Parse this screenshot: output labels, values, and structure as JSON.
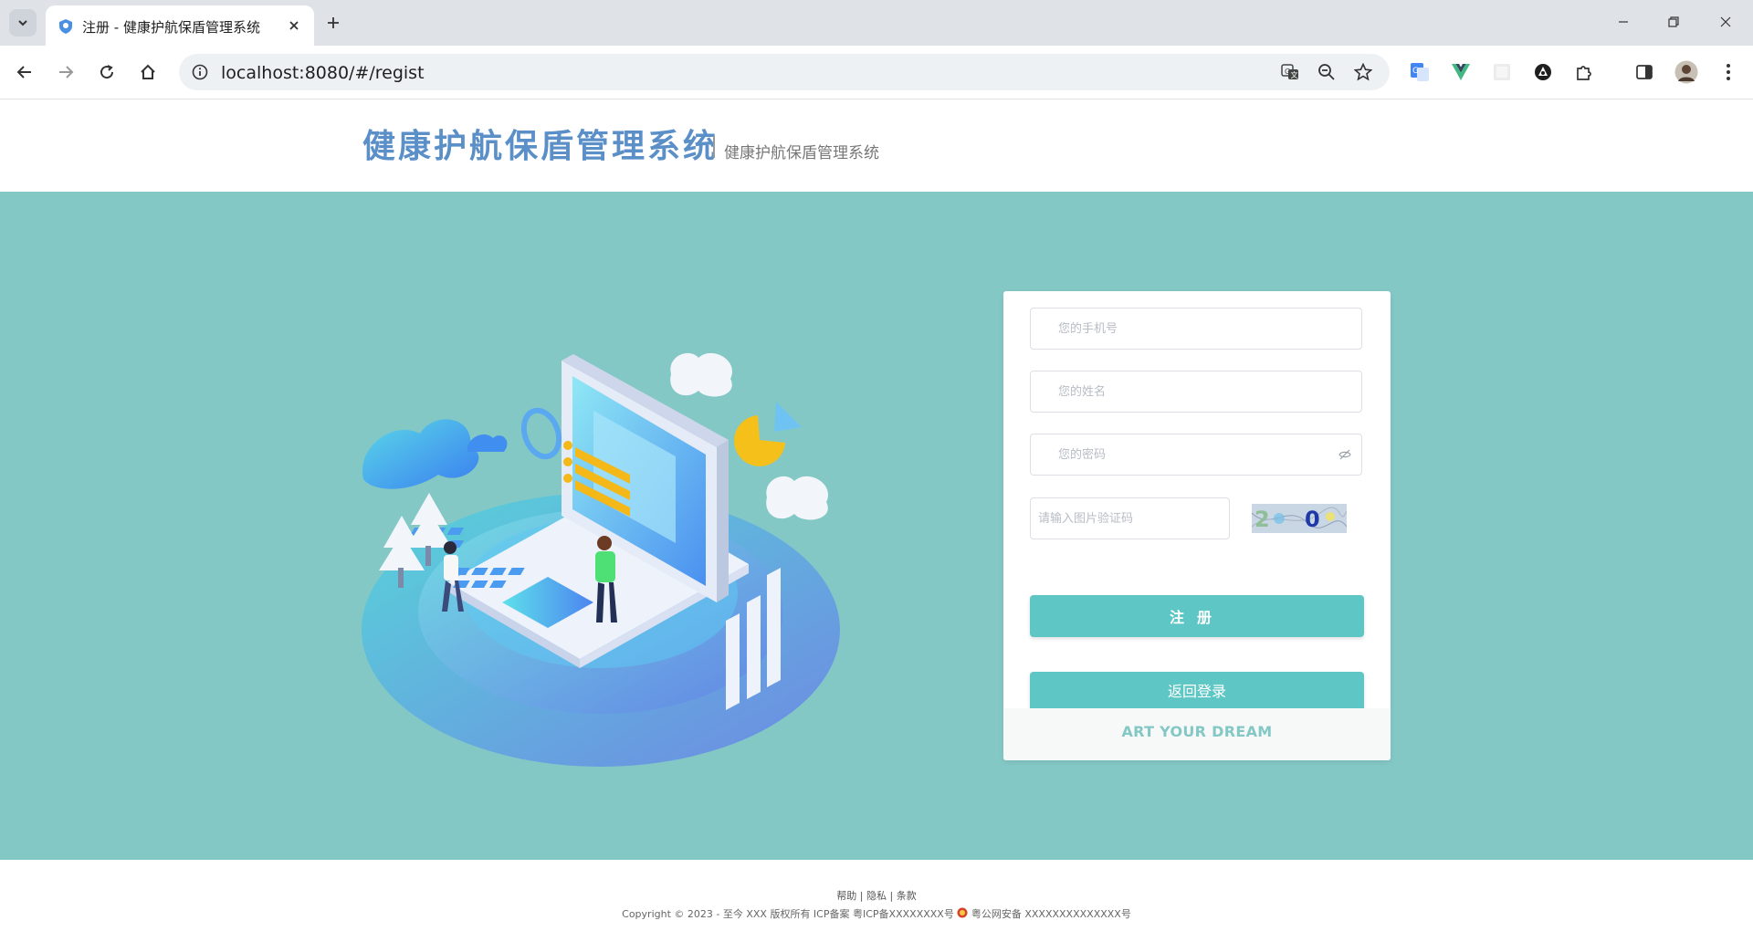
{
  "browser": {
    "tab_title": "注册 - 健康护航保盾管理系统",
    "url": "localhost:8080/#/regist",
    "icons": [
      "tab-search-icon",
      "close-icon",
      "plus-icon",
      "minimize-icon",
      "restore-icon",
      "close-window-icon",
      "back-arrow-icon",
      "forward-arrow-icon",
      "reload-icon",
      "home-icon",
      "site-info-icon",
      "translate-icon",
      "zoom-out-icon",
      "star-icon",
      "google-translate-icon",
      "vue-devtools-icon",
      "blank-extension-icon",
      "extension-icon",
      "puzzle-icon",
      "side-panel-icon",
      "avatar",
      "more-menu-icon"
    ]
  },
  "header": {
    "title": "健康护航保盾管理系统",
    "subtitle": "健康护航保盾管理系统"
  },
  "form": {
    "phone_placeholder": "您的手机号",
    "name_placeholder": "您的姓名",
    "password_placeholder": "您的密码",
    "captcha_placeholder": "请输入图片验证码",
    "captcha_text": "2 0",
    "register_label": "注册",
    "back_to_login_label": "返回登录",
    "slogan": "ART YOUR DREAM"
  },
  "footer": {
    "links": [
      "帮助",
      "隐私",
      "条款"
    ],
    "separator": "|",
    "copyright": "Copyright © 2023 - 至今 XXX 版权所有 ICP备案 粤ICP备XXXXXXXX号",
    "police": "粤公网安备 XXXXXXXXXXXXXX号"
  },
  "colors": {
    "hero_bg": "#84c8c6",
    "button": "#5ec6c4",
    "title": "#5b8fc8"
  }
}
